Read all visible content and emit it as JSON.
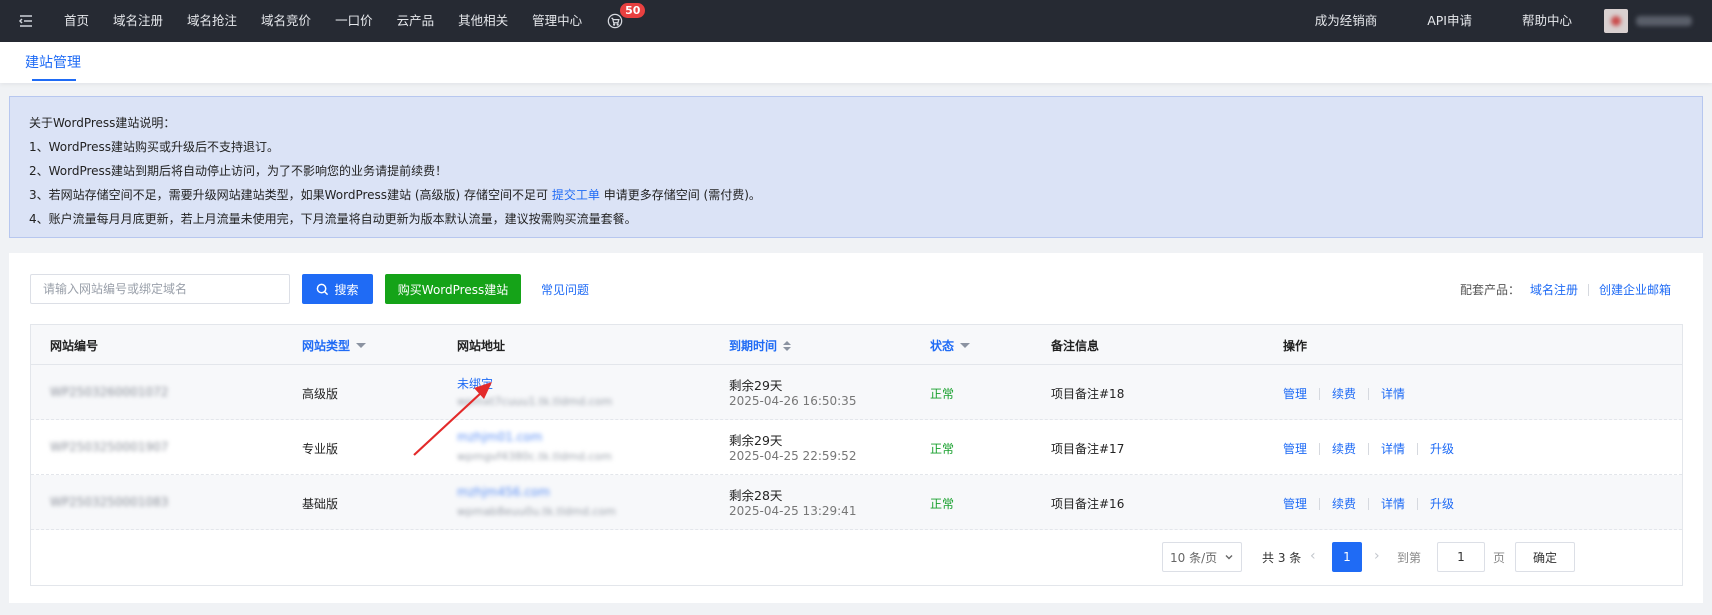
{
  "nav": {
    "items": [
      "首页",
      "域名注册",
      "域名抢注",
      "域名竞价",
      "一口价",
      "云产品",
      "其他相关",
      "管理中心"
    ],
    "cart_count": "50",
    "right_items": [
      "成为经销商",
      "API申请",
      "帮助中心"
    ]
  },
  "subheader": {
    "tab": "建站管理"
  },
  "notice": {
    "title": "关于WordPress建站说明：",
    "line1": "1、WordPress建站购买或升级后不支持退订。",
    "line2": "2、WordPress建站到期后将自动停止访问，为了不影响您的业务请提前续费！",
    "line3_pre": "3、若网站存储空间不足，需要升级网站建站类型，如果WordPress建站 (高级版) 存储空间不足可 ",
    "line3_link": "提交工单",
    "line3_post": " 申请更多存储空间 (需付费)。",
    "line4": "4、账户流量每月月底更新，若上月流量未使用完，下月流量将自动更新为版本默认流量，建议按需购买流量套餐。"
  },
  "toolbar": {
    "search_placeholder": "请输入网站编号或绑定域名",
    "search_label": "搜索",
    "buy_label": "购买WordPress建站",
    "faq_label": "常见问题",
    "related_label": "配套产品：",
    "related_links": [
      "域名注册",
      "创建企业邮箱"
    ]
  },
  "table": {
    "headers": {
      "id": "网站编号",
      "type": "网站类型",
      "address": "网站地址",
      "expire": "到期时间",
      "status": "状态",
      "note": "备注信息",
      "ops": "操作"
    },
    "rows": [
      {
        "id": "WP2503260001072",
        "type": "高级版",
        "address_main": "未绑定",
        "address_sub": "wpmxt7cuuu1.tk.tldmd.com",
        "expire_main": "剩余29天",
        "expire_time": "2025-04-26 16:50:35",
        "status": "正常",
        "note": "项目备注#18",
        "ops": [
          "管理",
          "续费",
          "详情"
        ]
      },
      {
        "id": "WP2503250001907",
        "type": "专业版",
        "address_main": "mzhjm01.com",
        "address_sub": "wpmgvf4380c.tk.tldmd.com",
        "expire_main": "剩余29天",
        "expire_time": "2025-04-25 22:59:52",
        "status": "正常",
        "note": "项目备注#17",
        "ops": [
          "管理",
          "续费",
          "详情",
          "升级"
        ]
      },
      {
        "id": "WP2503250001083",
        "type": "基础版",
        "address_main": "mzhjm456.com",
        "address_sub": "wpmab8euu0u.tk.tldmd.com",
        "expire_main": "剩余28天",
        "expire_time": "2025-04-25 13:29:41",
        "status": "正常",
        "note": "项目备注#16",
        "ops": [
          "管理",
          "续费",
          "详情",
          "升级"
        ]
      }
    ]
  },
  "pager": {
    "page_size": "10 条/页",
    "total": "共 3 条",
    "current": "1",
    "goto_label": "到第",
    "goto_value": "1",
    "page_label": "页",
    "confirm_label": "确定"
  },
  "colors": {
    "primary": "#1f6bf5",
    "buy": "#15a318",
    "status_ok": "#18a02d",
    "nav_bg": "#262a33"
  }
}
